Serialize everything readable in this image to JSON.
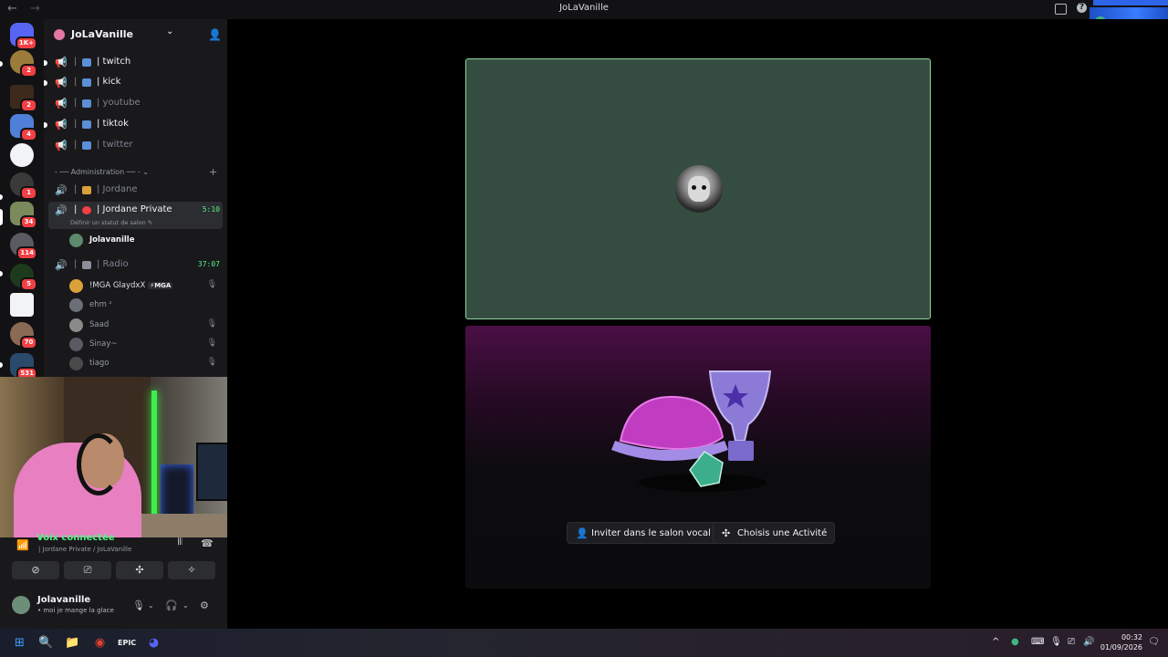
{
  "window": {
    "title": "JoLaVanille",
    "back": "←",
    "forward": "→"
  },
  "guilds": [
    {
      "badge": "1K+"
    },
    {
      "badge": "2"
    },
    {
      "badge": "2"
    },
    {
      "badge": "4"
    },
    {
      "badge": ""
    },
    {
      "badge": "1"
    },
    {
      "badge": "34"
    },
    {
      "badge": "114"
    },
    {
      "badge": "5"
    },
    {
      "badge": ""
    },
    {
      "badge": "70"
    },
    {
      "badge": "531"
    }
  ],
  "server": {
    "name": "JoLaVanille",
    "chevron": "⌄"
  },
  "channels": [
    {
      "name": "| twitch",
      "sep": "|",
      "bright": true,
      "unread": true
    },
    {
      "name": "| kick",
      "sep": "|",
      "bright": true,
      "unread": true
    },
    {
      "name": "| youtube",
      "sep": "|",
      "bright": false,
      "unread": false
    },
    {
      "name": "| tiktok",
      "sep": "|",
      "bright": true,
      "unread": true
    },
    {
      "name": "| twitter",
      "sep": "|",
      "bright": false,
      "unread": false
    }
  ],
  "category": {
    "label": "- ── Administration ── -  ⌄",
    "plus": "+"
  },
  "voice": {
    "jordane": {
      "name": "| Jordane",
      "sep": "|"
    },
    "private": {
      "name": "| Jordane Private",
      "sep": "|",
      "timer": "5:10",
      "hint": "Définir un statut de salon ✎"
    },
    "private_members": [
      {
        "name": "Jolavanille"
      }
    ],
    "radio": {
      "name": "| Radio",
      "sep": "|",
      "timer": "37:07"
    },
    "radio_members": [
      {
        "name": "!MGA GlaydxX",
        "tag": "⚡MGA"
      },
      {
        "name": "ehm ᶻ",
        "tag": ""
      },
      {
        "name": "Saad",
        "tag": ""
      },
      {
        "name": "Sinay~",
        "tag": ""
      },
      {
        "name": "tiago",
        "tag": ""
      }
    ]
  },
  "voice_panel": {
    "title": "Voix connectée",
    "subtitle": "| Jordane Private / JoLaVanille",
    "buttons": [
      "⊘",
      "⎚",
      "✣",
      "✧"
    ]
  },
  "user": {
    "name": "Jolavanille",
    "status": "• moi je mange la glace"
  },
  "stage": {
    "invite_label": "Inviter dans le salon vocal",
    "activity_label": "Choisis une Activité"
  },
  "taskbar": {
    "time": "00:32",
    "date": "01/09/2026"
  },
  "colors": {
    "accent_green": "#57f287",
    "tile_bg": "#354d40",
    "danger": "#f23f43",
    "brand": "#5865f2"
  }
}
